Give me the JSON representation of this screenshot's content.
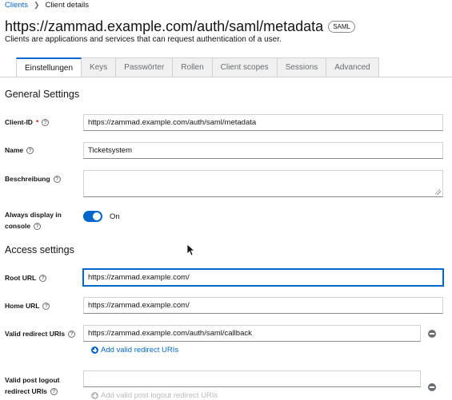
{
  "breadcrumb": {
    "parent": "Clients",
    "current": "Client details"
  },
  "header": {
    "title": "https://zammad.example.com/auth/saml/metadata",
    "badge": "SAML",
    "subtitle": "Clients are applications and services that can request authentication of a user."
  },
  "tabs": [
    {
      "label": "Einstellungen",
      "active": true
    },
    {
      "label": "Keys",
      "active": false
    },
    {
      "label": "Passwörter",
      "active": false
    },
    {
      "label": "Rollen",
      "active": false
    },
    {
      "label": "Client scopes",
      "active": false
    },
    {
      "label": "Sessions",
      "active": false
    },
    {
      "label": "Advanced",
      "active": false
    }
  ],
  "general": {
    "heading": "General Settings",
    "client_id_label": "Client-ID",
    "client_id_required": "*",
    "client_id_value": "https://zammad.example.com/auth/saml/metadata",
    "name_label": "Name",
    "name_value": "Ticketsystem",
    "description_label": "Beschreibung",
    "description_value": "",
    "always_display_label_line1": "Always display in",
    "always_display_label_line2": "console",
    "always_display_state": "On"
  },
  "access": {
    "heading": "Access settings",
    "root_url_label": "Root URL",
    "root_url_value": "https://zammad.example.com/",
    "home_url_label": "Home URL",
    "home_url_value": "https://zammad.example.com/",
    "redirect_label": "Valid redirect URIs",
    "redirect_value": "https://zammad.example.com/auth/saml/callback",
    "add_redirect": "Add valid redirect URIs",
    "post_logout_label_line1": "Valid post logout",
    "post_logout_label_line2": "redirect URIs",
    "post_logout_value": "",
    "add_post_logout": "Add valid post logout redirect URIs"
  },
  "icons": {
    "help": "?"
  },
  "colors": {
    "accent": "#0066cc",
    "required": "#c9190b"
  }
}
